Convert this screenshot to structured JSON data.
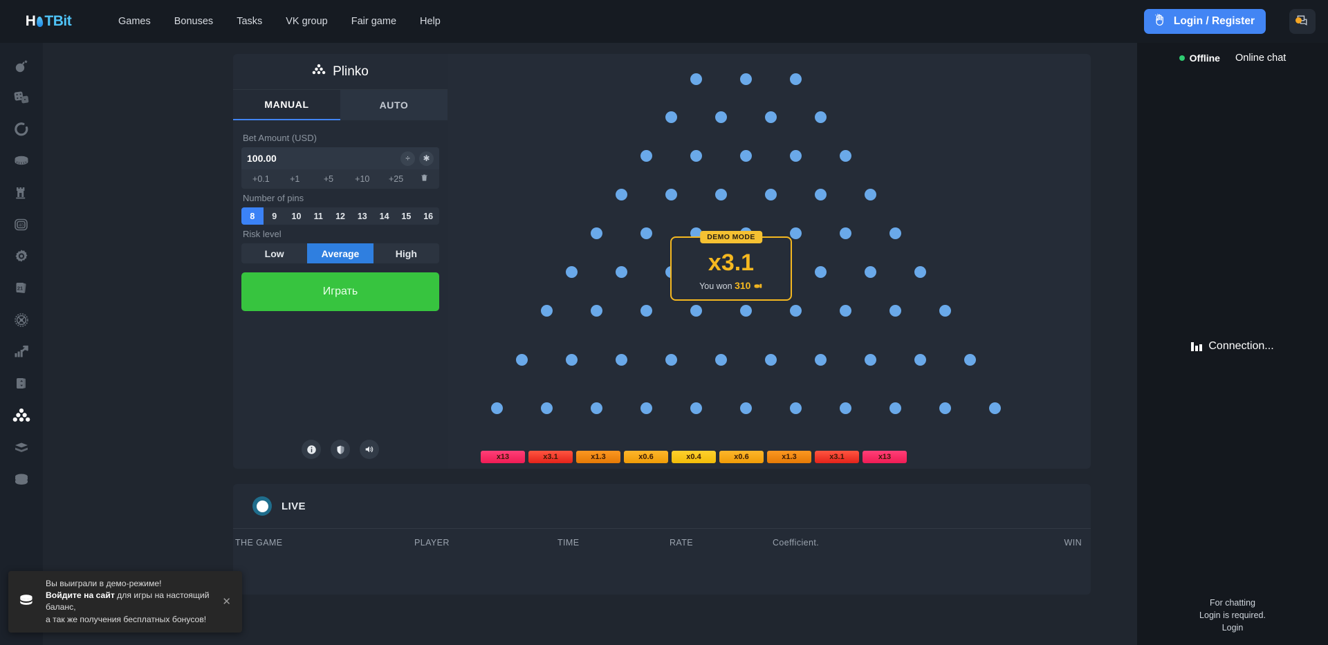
{
  "brand": {
    "name_a": "H",
    "name_flame": "flame-icon",
    "name_b": "TBit",
    "full": "HOTBit"
  },
  "topnav": {
    "links": [
      {
        "label": "Games"
      },
      {
        "label": "Bonuses"
      },
      {
        "label": "Tasks"
      },
      {
        "label": "VK group"
      },
      {
        "label": "Fair game"
      },
      {
        "label": "Help"
      }
    ],
    "login_label": "Login / Register",
    "login_icon": "waving-hands-icon",
    "chat_icon": "chat-bubbles-icon",
    "accent": "#4285f4"
  },
  "sidebar": {
    "items": [
      {
        "name": "mines",
        "icon": "bomb-icon",
        "active": false
      },
      {
        "name": "dice",
        "icon": "dice-icon",
        "active": false
      },
      {
        "name": "wheel",
        "icon": "ring-icon",
        "active": false
      },
      {
        "name": "coin",
        "icon": "coin-stack-icon",
        "active": false
      },
      {
        "name": "tower",
        "icon": "tower-icon",
        "active": false
      },
      {
        "name": "keno",
        "icon": "keno-40-icon",
        "label": "40",
        "active": false
      },
      {
        "name": "saw",
        "icon": "gear-icon",
        "active": false
      },
      {
        "name": "blackjack",
        "icon": "cards-21-icon",
        "label": "21",
        "active": false
      },
      {
        "name": "roulette",
        "icon": "roulette-icon",
        "active": false
      },
      {
        "name": "crash",
        "icon": "growth-chart-icon",
        "active": false
      },
      {
        "name": "hilo",
        "icon": "hilo-cards-icon",
        "active": false
      },
      {
        "name": "plinko",
        "icon": "plinko-pyramid-icon",
        "active": true
      },
      {
        "name": "slots",
        "icon": "slot-icon",
        "active": false
      },
      {
        "name": "chips",
        "icon": "chips-icon",
        "active": false
      }
    ]
  },
  "game": {
    "title": "Plinko",
    "title_icon": "plinko-pyramid-icon",
    "tabs": [
      {
        "label": "MANUAL",
        "active": true
      },
      {
        "label": "AUTO",
        "active": false
      }
    ],
    "bet": {
      "label": "Bet Amount (USD)",
      "value": "100.00",
      "divide_icon": "divide-icon",
      "multiply_icon": "multiply-icon",
      "quick": [
        "+0.1",
        "+1",
        "+5",
        "+10",
        "+25"
      ],
      "clear_icon": "trash-icon"
    },
    "pins": {
      "label": "Number of pins",
      "options": [
        "8",
        "9",
        "10",
        "11",
        "12",
        "13",
        "14",
        "15",
        "16"
      ],
      "selected": "8"
    },
    "risk": {
      "label": "Risk level",
      "options": [
        "Low",
        "Average",
        "High"
      ],
      "selected": "Average"
    },
    "play_label": "Играть",
    "footer_icons": [
      {
        "name": "info-icon",
        "glyph": "i"
      },
      {
        "name": "shield-icon",
        "glyph": "shield"
      },
      {
        "name": "sound-icon",
        "glyph": "sound"
      }
    ]
  },
  "win_popup": {
    "badge": "DEMO MODE",
    "multiplier": "x3.1",
    "won_prefix": "You won",
    "won_amount": "310",
    "coin_icon": "coin-stack-icon",
    "border_color": "#f5b820"
  },
  "multipliers": [
    {
      "label": "x13",
      "color": "#ff2d6b"
    },
    {
      "label": "x3.1",
      "color": "#fa3c2e"
    },
    {
      "label": "x1.3",
      "color": "#f98a12"
    },
    {
      "label": "x0.6",
      "color": "#fbac14"
    },
    {
      "label": "x0.4",
      "color": "#fcc81a"
    },
    {
      "label": "x0.6",
      "color": "#fbac14"
    },
    {
      "label": "x1.3",
      "color": "#f98a12"
    },
    {
      "label": "x3.1",
      "color": "#fa3c2e"
    },
    {
      "label": "x13",
      "color": "#ff2d6b"
    }
  ],
  "live": {
    "toggle_label": "LIVE",
    "columns": [
      "THE GAME",
      "PLAYER",
      "TIME",
      "RATE",
      "Coefficient.",
      "WIN"
    ]
  },
  "chat": {
    "status": "Offline",
    "status_color": "#2ecc71",
    "title": "Online chat",
    "connection": "Connection...",
    "connection_icon": "signal-bars-icon",
    "footer_line1": "For chatting",
    "footer_line2": "Login is required.",
    "footer_link": "Login"
  },
  "toast": {
    "icon": "coin-stack-icon",
    "line1": "Вы выиграли в демо-режиме!",
    "line2_bold": "Войдите на сайт",
    "line2_rest": " для игры на настоящий баланс,",
    "line3": "а так же получения бесплатных бонусов!",
    "close_icon": "close-icon"
  }
}
